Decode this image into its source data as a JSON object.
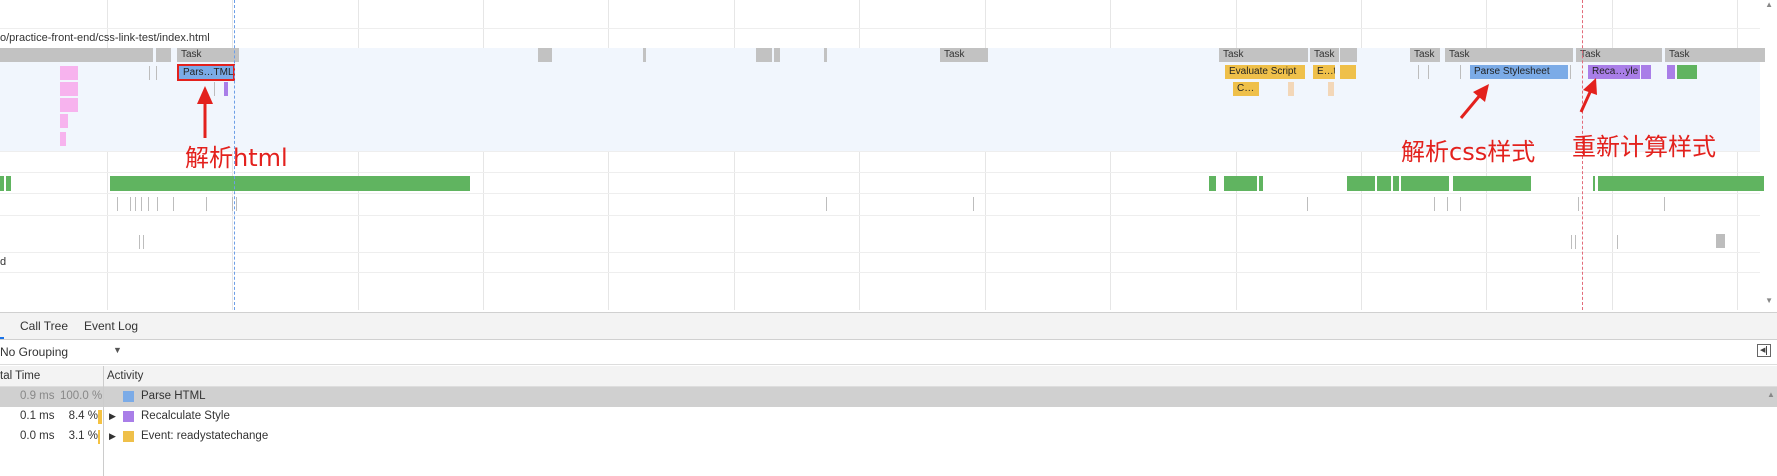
{
  "timeline": {
    "url": "o/practice-front-end/css-link-test/index.html",
    "tasks": [
      "Task",
      "Task",
      "Task",
      "Task",
      "Task",
      "Task",
      "Task",
      "Task",
      "Task"
    ],
    "events": {
      "parse_html_short": "Pars…TML",
      "evaluate_script": "Evaluate Script",
      "e_short": "E…t",
      "c_short": "C…",
      "parse_stylesheet": "Parse Stylesheet",
      "recalc_short": "Reca…yle"
    },
    "side_label_d": "d"
  },
  "annotations": {
    "parse_html": "解析html",
    "parse_css": "解析css样式",
    "recalc": "重新计算样式"
  },
  "tabs": {
    "first": "",
    "call_tree": "Call Tree",
    "event_log": "Event Log"
  },
  "grouping": {
    "selected": "No Grouping"
  },
  "columns": {
    "total_time": "tal Time",
    "activity": "Activity"
  },
  "rows": [
    {
      "time": "0.9 ms",
      "pct": "100.0 %",
      "name": "Parse HTML",
      "color": "#7babe7",
      "expandable": false
    },
    {
      "time": "0.1 ms",
      "pct": "8.4 %",
      "name": "Recalculate Style",
      "color": "#a97ee8",
      "expandable": true
    },
    {
      "time": "0.0 ms",
      "pct": "3.1 %",
      "name": "Event: readystatechange",
      "color": "#efc04a",
      "expandable": true
    }
  ],
  "icons": {
    "dropdown": "triangle-down-icon",
    "expand": "triangle-right-icon",
    "sidebar_toggle": "panel-toggle-icon"
  }
}
